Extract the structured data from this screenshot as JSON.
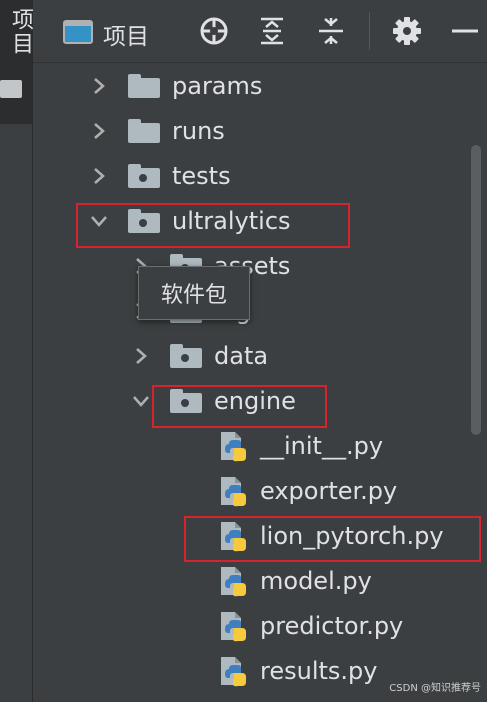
{
  "sidebar": {
    "project_tab_label": "项目"
  },
  "toolbar": {
    "title": "项目",
    "buttons": [
      "locate-icon",
      "expand-all-icon",
      "collapse-all-icon",
      "gear-icon",
      "minimize-icon"
    ]
  },
  "tree": {
    "items": [
      {
        "label": "params",
        "type": "folder",
        "expanded": false
      },
      {
        "label": "runs",
        "type": "folder",
        "expanded": false
      },
      {
        "label": "tests",
        "type": "package",
        "expanded": false
      },
      {
        "label": "ultralytics",
        "type": "package",
        "expanded": true
      },
      {
        "label": "assets",
        "type": "package",
        "expanded": false
      },
      {
        "label": "cfg",
        "type": "package",
        "expanded": false
      },
      {
        "label": "data",
        "type": "package",
        "expanded": false
      },
      {
        "label": "engine",
        "type": "package",
        "expanded": true
      },
      {
        "label": "__init__.py",
        "type": "python-file"
      },
      {
        "label": "exporter.py",
        "type": "python-file"
      },
      {
        "label": "lion_pytorch.py",
        "type": "python-file"
      },
      {
        "label": "model.py",
        "type": "python-file"
      },
      {
        "label": "predictor.py",
        "type": "python-file"
      },
      {
        "label": "results.py",
        "type": "python-file"
      }
    ]
  },
  "tooltip": {
    "text": "软件包"
  },
  "watermark": "CSDN @知识推荐号",
  "colors": {
    "background": "#3c3f41",
    "highlight_box": "#d7232d",
    "python_blue": "#3f7fbf",
    "python_yellow": "#f7c93c"
  }
}
